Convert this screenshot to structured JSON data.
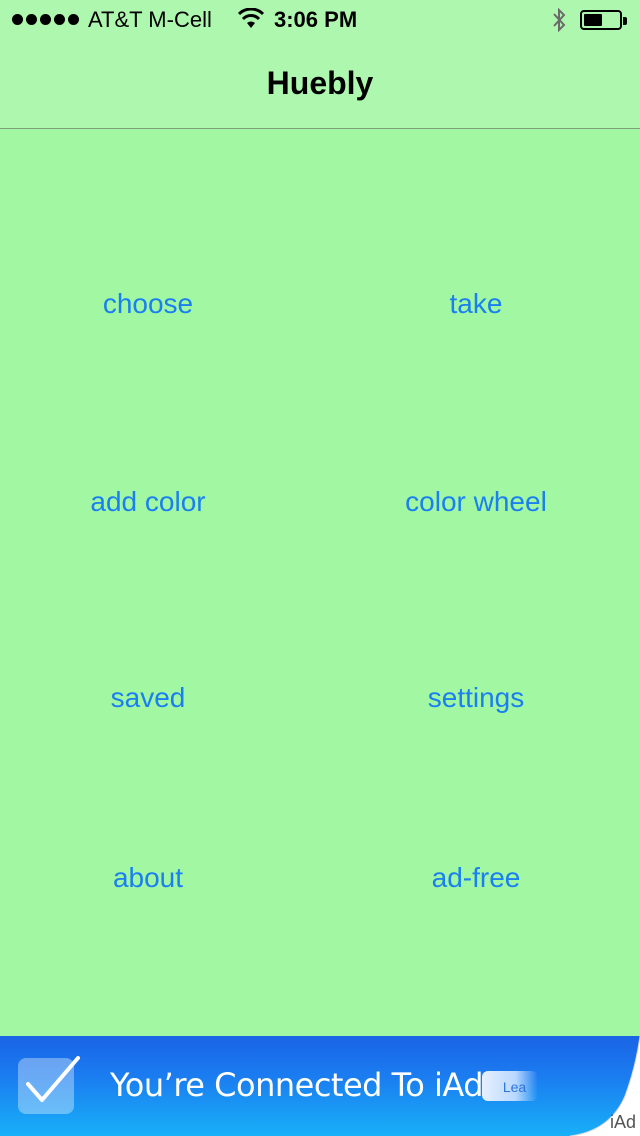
{
  "status_bar": {
    "carrier": "AT&T M-Cell",
    "time": "3:06 PM",
    "signal_icon": "signal-dots-icon",
    "wifi_icon": "wifi-icon",
    "bluetooth_icon": "bluetooth-icon",
    "battery_icon": "battery-icon",
    "battery_level": 0.45
  },
  "nav": {
    "title": "Huebly"
  },
  "menu": {
    "choose": "choose",
    "take": "take",
    "add_color": "add color",
    "color_wheel": "color wheel",
    "saved": "saved",
    "settings": "settings",
    "about": "about",
    "ad_free": "ad-free"
  },
  "ad": {
    "text": "You’re Connected To iAd",
    "learn_label": "Lea",
    "iad_label": "iAd",
    "check_icon": "checkmark-icon"
  },
  "colors": {
    "background": "#a2f8a2",
    "nav_background": "#aef7ae",
    "button_text": "#1a7ff0",
    "ad_blue": "#1b7cf0"
  }
}
